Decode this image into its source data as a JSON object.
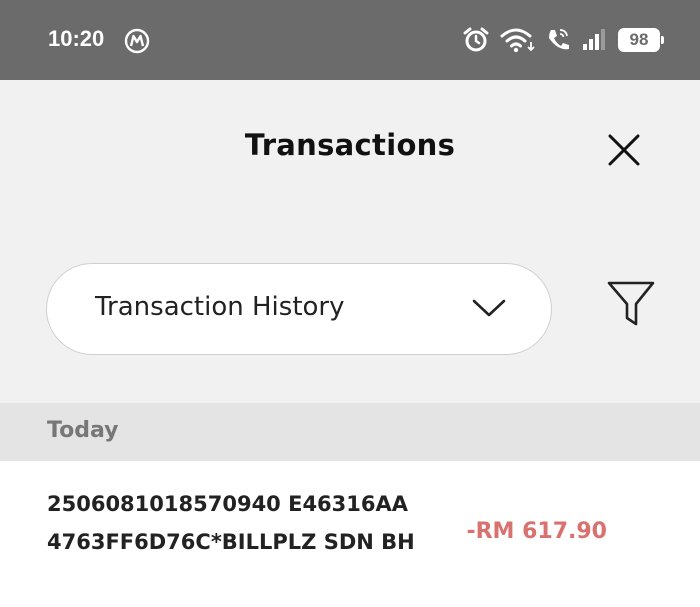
{
  "status_bar": {
    "time": "10:20",
    "battery": "98",
    "icons": [
      "motorola-logo-icon",
      "alarm-icon",
      "wifi-icon",
      "wifi-calling-icon",
      "signal-icon",
      "battery-icon"
    ]
  },
  "header": {
    "title": "Transactions",
    "close_icon": "close-icon"
  },
  "filter_bar": {
    "dropdown_value": "Transaction History",
    "dropdown_icon": "chevron-down-icon",
    "filter_icon": "filter-icon"
  },
  "sections": [
    {
      "label": "Today",
      "transactions": [
        {
          "description": "2506081018570940 E46316AA 4763FF6D76C*BILLPLZ SDN BH",
          "amount": "-RM 617.90"
        }
      ]
    }
  ],
  "colors": {
    "status_bar_bg": "#6b6b6b",
    "page_bg": "#f1f1f1",
    "section_bg": "#e4e4e4",
    "debit_amount": "#d9716f"
  }
}
